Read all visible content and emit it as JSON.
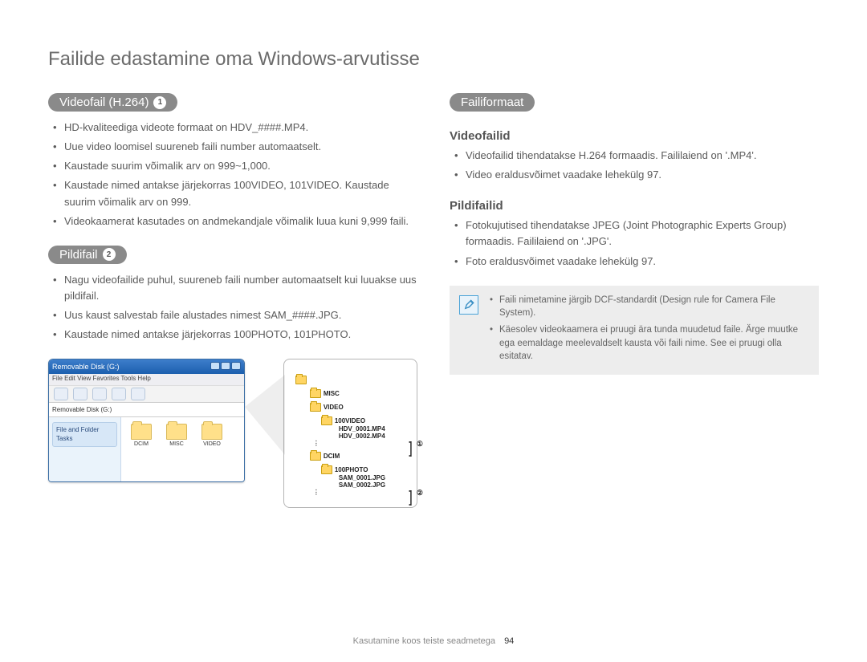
{
  "page_title": "Failide edastamine oma Windows-arvutisse",
  "left": {
    "videofail_label": "Videofail (H.264)",
    "videofail_badge": "1",
    "video_points": [
      "HD-kvaliteediga videote formaat on HDV_####.MP4.",
      "Uue video loomisel suureneb faili number automaatselt.",
      "Kaustade suurim võimalik arv on 999~1,000.",
      "Kaustade nimed antakse järjekorras 100VIDEO, 101VIDEO. Kaustade suurim võimalik arv on 999.",
      "Videokaamerat kasutades on andmekandjale võimalik luua kuni 9,999 faili."
    ],
    "pildifail_label": "Pildifail",
    "pildifail_badge": "2",
    "pildi_points": [
      "Nagu videofailide puhul, suureneb faili number automaatselt kui luuakse uus pildifail.",
      "Uus kaust salvestab faile alustades nimest SAM_####.JPG.",
      "Kaustade nimed antakse järjekorras 100PHOTO, 101PHOTO."
    ]
  },
  "right": {
    "failiformaat_label": "Failiformaat",
    "videofailid_heading": "Videofailid",
    "videofailid_points": [
      "Videofailid tihendatakse H.264 formaadis. Faililaiend on '.MP4'.",
      "Video eraldusvõimet vaadake lehekülg 97."
    ],
    "pildifailid_heading": "Pildifailid",
    "pildifailid_points": [
      "Fotokujutised tihendatakse JPEG (Joint Photographic Experts Group) formaadis. Faililaiend on '.JPG'.",
      "Foto eraldusvõimet vaadake lehekülg 97."
    ],
    "note_points": [
      "Faili nimetamine järgib DCF-standardit (Design rule for Camera File System).",
      "Käesolev videokaamera ei pruugi ära tunda muudetud faile. Ärge muutke ega eemaldage meelevaldselt kausta või faili nime. See ei pruugi olla esitatav."
    ]
  },
  "explorer": {
    "title": "Removable Disk (G:)",
    "menu": "File   Edit   View   Favorites   Tools   Help",
    "folders": [
      "DCIM",
      "MISC",
      "VIDEO"
    ],
    "side_title": "File and Folder Tasks"
  },
  "tree": {
    "root_misc": "MISC",
    "root_video": "VIDEO",
    "video_sub": "100VIDEO",
    "video_files": [
      "HDV_0001.MP4",
      "HDV_0002.MP4"
    ],
    "callout1": "①",
    "root_dcim": "DCIM",
    "dcim_sub": "100PHOTO",
    "dcim_files": [
      "SAM_0001.JPG",
      "SAM_0002.JPG"
    ],
    "callout2": "②"
  },
  "footer": {
    "section": "Kasutamine koos teiste seadmetega",
    "page": "94"
  }
}
